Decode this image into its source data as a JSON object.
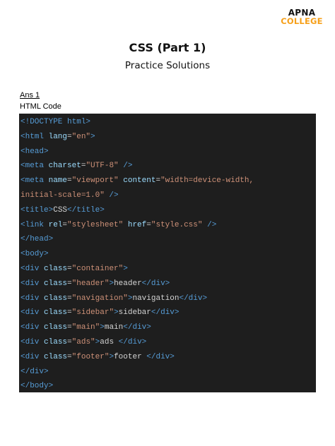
{
  "brand": {
    "line1": "APNA",
    "line2": "COLLEGE"
  },
  "title": "CSS (Part 1)",
  "subtitle": "Practice Solutions",
  "answer_label": "Ans 1",
  "code_label": "HTML Code",
  "colors": {
    "code_background": "#1e1e1e",
    "tag": "#569cd6",
    "attribute": "#9cdcfe",
    "value": "#ce9178",
    "text": "#d4d4d4",
    "brand_accent": "#f6a01a"
  },
  "code_lines": [
    [
      [
        "t-tag",
        "<!DOCTYPE html>"
      ]
    ],
    [
      [
        "t-tag",
        "<html "
      ],
      [
        "t-attr",
        "lang"
      ],
      [
        "t-text",
        "="
      ],
      [
        "t-val",
        "\"en\""
      ],
      [
        "t-tag",
        ">"
      ]
    ],
    [
      [
        "t-tag",
        "<head>"
      ]
    ],
    [
      [
        "t-tag",
        "<meta "
      ],
      [
        "t-attr",
        "charset"
      ],
      [
        "t-text",
        "="
      ],
      [
        "t-val",
        "\"UTF-8\""
      ],
      [
        "t-tag",
        " />"
      ]
    ],
    [
      [
        "t-tag",
        "<meta "
      ],
      [
        "t-attr",
        "name"
      ],
      [
        "t-text",
        "="
      ],
      [
        "t-val",
        "\"viewport\""
      ],
      [
        "t-text",
        " "
      ],
      [
        "t-attr",
        "content"
      ],
      [
        "t-text",
        "="
      ],
      [
        "t-val",
        "\"width=device-width,"
      ]
    ],
    [
      [
        "t-val",
        "initial-scale=1.0\""
      ],
      [
        "t-tag",
        " />"
      ]
    ],
    [
      [
        "t-tag",
        "<title>"
      ],
      [
        "t-text",
        "CSS"
      ],
      [
        "t-tag",
        "</title>"
      ]
    ],
    [
      [
        "t-tag",
        "<link "
      ],
      [
        "t-attr",
        "rel"
      ],
      [
        "t-text",
        "="
      ],
      [
        "t-val",
        "\"stylesheet\""
      ],
      [
        "t-text",
        " "
      ],
      [
        "t-attr",
        "href"
      ],
      [
        "t-text",
        "="
      ],
      [
        "t-val",
        "\"style.css\""
      ],
      [
        "t-tag",
        " />"
      ]
    ],
    [
      [
        "t-tag",
        "</head>"
      ]
    ],
    [
      [
        "t-tag",
        "<body>"
      ]
    ],
    [
      [
        "t-tag",
        "<div "
      ],
      [
        "t-attr",
        "class"
      ],
      [
        "t-text",
        "="
      ],
      [
        "t-val",
        "\"container\""
      ],
      [
        "t-tag",
        ">"
      ]
    ],
    [
      [
        "t-tag",
        "<div "
      ],
      [
        "t-attr",
        "class"
      ],
      [
        "t-text",
        "="
      ],
      [
        "t-val",
        "\"header\""
      ],
      [
        "t-tag",
        ">"
      ],
      [
        "t-text",
        "header"
      ],
      [
        "t-tag",
        "</div>"
      ]
    ],
    [
      [
        "t-tag",
        "<div "
      ],
      [
        "t-attr",
        "class"
      ],
      [
        "t-text",
        "="
      ],
      [
        "t-val",
        "\"navigation\""
      ],
      [
        "t-tag",
        ">"
      ],
      [
        "t-text",
        "navigation"
      ],
      [
        "t-tag",
        "</div>"
      ]
    ],
    [
      [
        "t-tag",
        "<div "
      ],
      [
        "t-attr",
        "class"
      ],
      [
        "t-text",
        "="
      ],
      [
        "t-val",
        "\"sidebar\""
      ],
      [
        "t-tag",
        ">"
      ],
      [
        "t-text",
        "sidebar"
      ],
      [
        "t-tag",
        "</div>"
      ]
    ],
    [
      [
        "t-tag",
        "<div "
      ],
      [
        "t-attr",
        "class"
      ],
      [
        "t-text",
        "="
      ],
      [
        "t-val",
        "\"main\""
      ],
      [
        "t-tag",
        ">"
      ],
      [
        "t-text",
        "main"
      ],
      [
        "t-tag",
        "</div>"
      ]
    ],
    [
      [
        "t-tag",
        "<div "
      ],
      [
        "t-attr",
        "class"
      ],
      [
        "t-text",
        "="
      ],
      [
        "t-val",
        "\"ads\""
      ],
      [
        "t-tag",
        ">"
      ],
      [
        "t-text",
        "ads "
      ],
      [
        "t-tag",
        "</div>"
      ]
    ],
    [
      [
        "t-tag",
        "<div "
      ],
      [
        "t-attr",
        "class"
      ],
      [
        "t-text",
        "="
      ],
      [
        "t-val",
        "\"footer\""
      ],
      [
        "t-tag",
        ">"
      ],
      [
        "t-text",
        "footer "
      ],
      [
        "t-tag",
        "</div>"
      ]
    ],
    [
      [
        "t-tag",
        "</div>"
      ]
    ],
    [
      [
        "t-tag",
        "</body>"
      ]
    ]
  ]
}
